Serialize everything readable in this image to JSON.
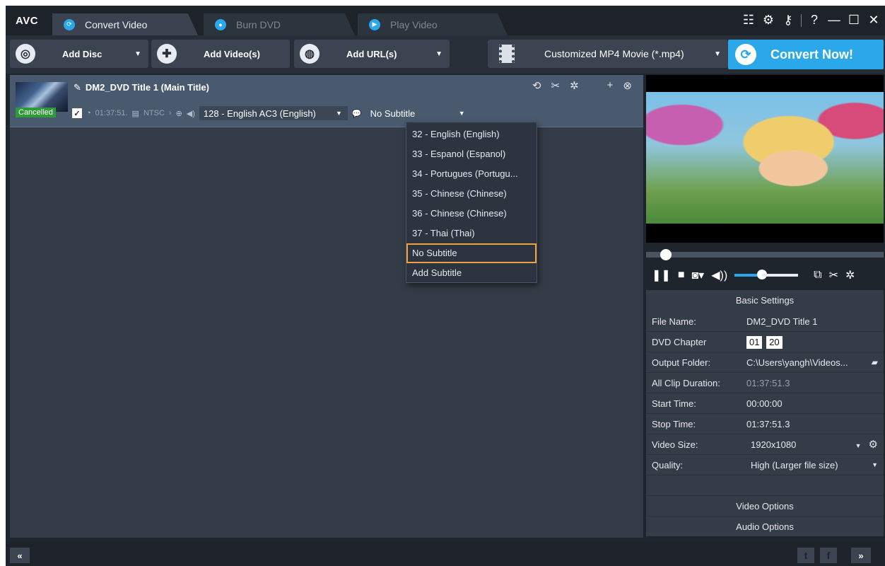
{
  "app": {
    "logo": "AVC"
  },
  "tabs": [
    {
      "label": "Convert Video",
      "icon": "refresh-icon",
      "active": true
    },
    {
      "label": "Burn DVD",
      "icon": "disc-icon",
      "active": false
    },
    {
      "label": "Play Video",
      "icon": "play-icon",
      "active": false
    }
  ],
  "window_controls": {
    "menu": "☷",
    "settings": "⚙",
    "key": "⚷",
    "help": "?",
    "minimize": "—",
    "maximize": "☐",
    "close": "✕"
  },
  "toolbar": {
    "add_disc": "Add Disc",
    "add_videos": "Add Video(s)",
    "add_url": "Add URL(s)",
    "profile": "Customized MP4 Movie (*.mp4)",
    "convert": "Convert Now!"
  },
  "item": {
    "title": "DM2_DVD Title 1 (Main Title)",
    "status": "Cancelled",
    "duration": "01:37:51.",
    "format": "NTSC",
    "audio": "128 - English AC3 (English)",
    "subtitle": "No Subtitle"
  },
  "subtitle_menu": {
    "items": [
      "32 - English (English)",
      "33 - Espanol (Espanol)",
      "34 - Portugues (Portugu...",
      "35 - Chinese (Chinese)",
      "36 - Chinese (Chinese)",
      "37 - Thai (Thai)",
      "No Subtitle",
      "Add Subtitle"
    ],
    "selected_index": 6
  },
  "player": {
    "seek_fraction": 0.06,
    "volume_fraction": 0.43
  },
  "settings": {
    "header": "Basic Settings",
    "file_name_label": "File Name:",
    "file_name": "DM2_DVD Title 1",
    "dvd_chapter_label": "DVD Chapter",
    "chapter_start": "01",
    "chapter_end": "20",
    "output_folder_label": "Output Folder:",
    "output_folder": "C:\\Users\\yangh\\Videos...",
    "all_clip_duration_label": "All Clip Duration:",
    "all_clip_duration": "01:37:51.3",
    "start_time_label": "Start Time:",
    "start_time": "00:00:00",
    "stop_time_label": "Stop Time:",
    "stop_time": "01:37:51.3",
    "video_size_label": "Video Size:",
    "video_size": "1920x1080",
    "quality_label": "Quality:",
    "quality": "High (Larger file size)",
    "video_options": "Video Options",
    "audio_options": "Audio Options"
  },
  "bottom": {
    "collapse": "«",
    "expand": "»",
    "twitter": "t",
    "facebook": "f"
  },
  "colors": {
    "accent": "#2aa8e9",
    "cancelled": "#2f9a38",
    "selected_border": "#f0a040"
  }
}
